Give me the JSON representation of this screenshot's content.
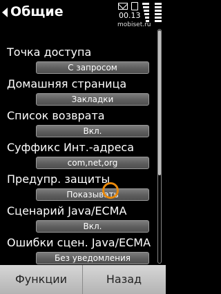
{
  "header": {
    "title": "Общие",
    "time": "00.13",
    "watermark": "mobiset.ru"
  },
  "settings": [
    {
      "label": "Точка доступа",
      "value": "С запросом"
    },
    {
      "label": "Домашняя страница",
      "value": "Закладки"
    },
    {
      "label": "Список возврата",
      "value": "Вкл."
    },
    {
      "label": "Суффикс Инт.-адреса",
      "value": "com,net,org"
    },
    {
      "label": "Предупр. защиты",
      "value": "Показывать"
    },
    {
      "label": "Сценарий Java/ECMA",
      "value": "Вкл."
    },
    {
      "label": "Ошибки сцен. Java/ECMA",
      "value": "Без уведомления"
    }
  ],
  "softkeys": {
    "left": "Функции",
    "right": "Назад"
  },
  "icons": {
    "back": "back-arrow-icon",
    "mail": "envelope-icon",
    "sim": "sim-icon",
    "signal": "signal-strength-icon",
    "battery": "battery-level-icon"
  }
}
